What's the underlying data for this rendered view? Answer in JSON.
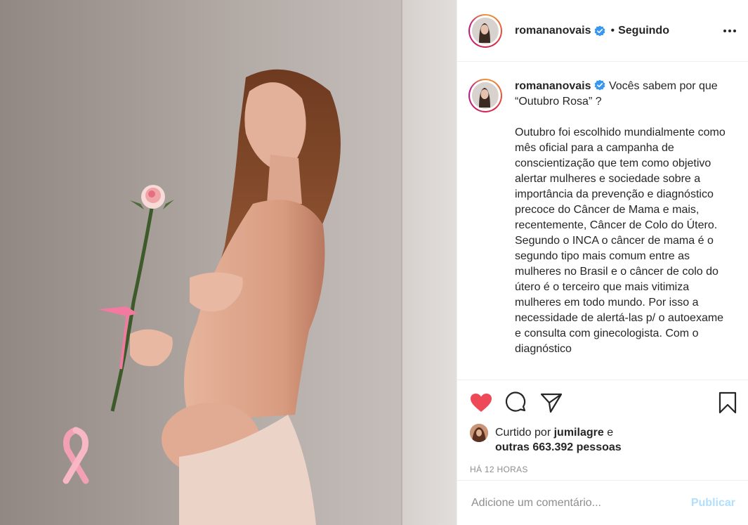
{
  "post": {
    "username": "romananovais",
    "verified_icon": "verified-badge-icon",
    "follow_separator": "•",
    "follow_state": "Seguindo",
    "more_icon": "more-options-icon"
  },
  "caption": {
    "username": "romananovais",
    "line1": "Vocês sabem por que “Outubro Rosa” ?",
    "body": "Outubro foi escolhido mundialmente como mês oficial para a campanha de conscientização que tem como objetivo alertar mulheres e sociedade sobre a importância da prevenção e diagnóstico precoce do Câncer de Mama e mais, recentemente, Câncer de Colo do Útero. Segundo o INCA o câncer de mama é o segundo tipo mais comum entre as mulheres no Brasil e o câncer de colo do útero é o terceiro que mais vitimiza mulheres em todo mundo. Por isso a necessidade de alertá-las p/ o autoexame e consulta com ginecologista. Com o diagnóstico"
  },
  "actions": {
    "like_icon": "heart-filled-icon",
    "comment_icon": "comment-icon",
    "share_icon": "share-icon",
    "save_icon": "bookmark-icon",
    "like_color": "#ed4956"
  },
  "likes": {
    "prefix": "Curtido por",
    "user": "jumilagre",
    "conjunction": "e",
    "others": "outras 663.392 pessoas"
  },
  "timestamp": "HÁ 12 HORAS",
  "comment": {
    "placeholder": "Adicione um comentário...",
    "publish_label": "Publicar",
    "publish_color": "#b2dffc"
  }
}
